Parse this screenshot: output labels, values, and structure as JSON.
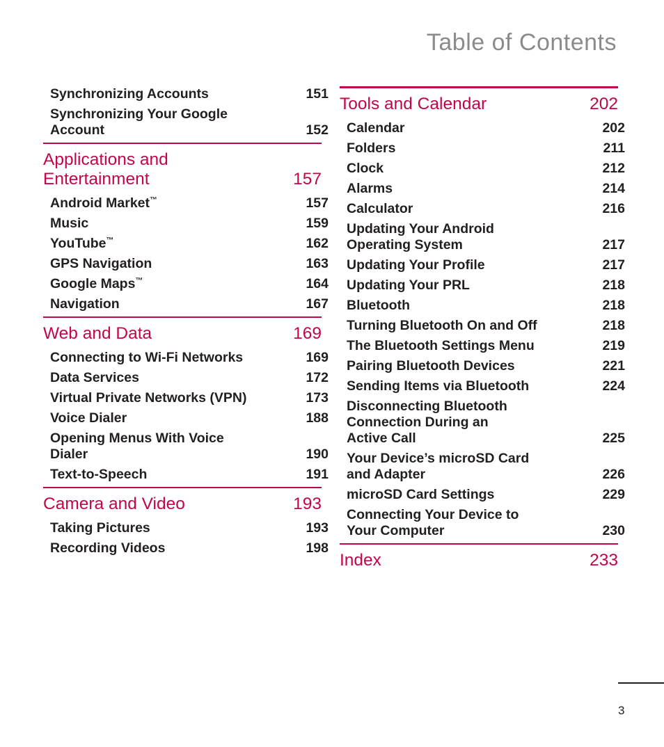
{
  "header": {
    "title": "Table of Contents",
    "title_color": "#8b8b8b"
  },
  "theme": {
    "accent": "#c2064a",
    "text": "#231f20"
  },
  "footer": {
    "page_number": "3"
  },
  "columns": {
    "left": {
      "items": [
        {
          "kind": "item",
          "title": "Synchronizing Accounts",
          "page": "151"
        },
        {
          "kind": "item",
          "title": "Synchronizing Your Google\nAccount",
          "page": "152"
        },
        {
          "kind": "rule"
        },
        {
          "kind": "section",
          "title": "Applications and\nEntertainment",
          "page": "157"
        },
        {
          "kind": "item",
          "title": "Android Market",
          "tm": true,
          "page": "157"
        },
        {
          "kind": "item",
          "title": "Music",
          "page": "159"
        },
        {
          "kind": "item",
          "title": "YouTube",
          "tm": true,
          "page": "162"
        },
        {
          "kind": "item",
          "title": "GPS Navigation",
          "page": "163"
        },
        {
          "kind": "item",
          "title": "Google Maps",
          "tm": true,
          "page": "164"
        },
        {
          "kind": "item",
          "title": "Navigation",
          "page": "167"
        },
        {
          "kind": "rule"
        },
        {
          "kind": "section",
          "title": "Web and Data",
          "page": "169"
        },
        {
          "kind": "item",
          "title": "Connecting to Wi-Fi Networks",
          "page": "169"
        },
        {
          "kind": "item",
          "title": "Data Services",
          "page": "172"
        },
        {
          "kind": "item",
          "title": "Virtual Private Networks (VPN)",
          "page": "173"
        },
        {
          "kind": "item",
          "title": "Voice Dialer",
          "page": "188"
        },
        {
          "kind": "item",
          "title": "Opening Menus With Voice\nDialer",
          "page": "190"
        },
        {
          "kind": "item",
          "title": "Text-to-Speech",
          "page": "191"
        },
        {
          "kind": "rule"
        },
        {
          "kind": "section",
          "title": "Camera and Video",
          "page": "193"
        },
        {
          "kind": "item",
          "title": "Taking Pictures",
          "page": "193"
        },
        {
          "kind": "item",
          "title": "Recording Videos",
          "page": "198"
        }
      ]
    },
    "right": {
      "items": [
        {
          "kind": "rule",
          "thick": true
        },
        {
          "kind": "section",
          "title": "Tools and Calendar",
          "page": "202"
        },
        {
          "kind": "item",
          "title": "Calendar",
          "page": "202"
        },
        {
          "kind": "item",
          "title": "Folders",
          "page": "211"
        },
        {
          "kind": "item",
          "title": "Clock",
          "page": "212"
        },
        {
          "kind": "item",
          "title": "Alarms",
          "page": "214"
        },
        {
          "kind": "item",
          "title": "Calculator",
          "page": "216"
        },
        {
          "kind": "item",
          "title": "Updating Your Android\nOperating System",
          "page": "217"
        },
        {
          "kind": "item",
          "title": "Updating Your Profile",
          "page": "217"
        },
        {
          "kind": "item",
          "title": "Updating Your PRL",
          "page": "218"
        },
        {
          "kind": "item",
          "title": "Bluetooth",
          "page": "218"
        },
        {
          "kind": "item",
          "title": "Turning Bluetooth On and Off",
          "page": "218"
        },
        {
          "kind": "item",
          "title": "The Bluetooth Settings Menu",
          "page": "219"
        },
        {
          "kind": "item",
          "title": "Pairing Bluetooth Devices",
          "page": "221"
        },
        {
          "kind": "item",
          "title": "Sending Items via Bluetooth",
          "page": "224"
        },
        {
          "kind": "item",
          "title": "Disconnecting Bluetooth\nConnection During an\nActive Call",
          "page": "225"
        },
        {
          "kind": "item",
          "title": "Your Device’s microSD Card\nand Adapter",
          "page": "226"
        },
        {
          "kind": "item",
          "title": "microSD Card Settings",
          "page": "229"
        },
        {
          "kind": "item",
          "title": "Connecting Your Device to\nYour Computer",
          "page": "230"
        },
        {
          "kind": "rule"
        },
        {
          "kind": "section",
          "title": "Index",
          "page": "233"
        }
      ]
    }
  }
}
